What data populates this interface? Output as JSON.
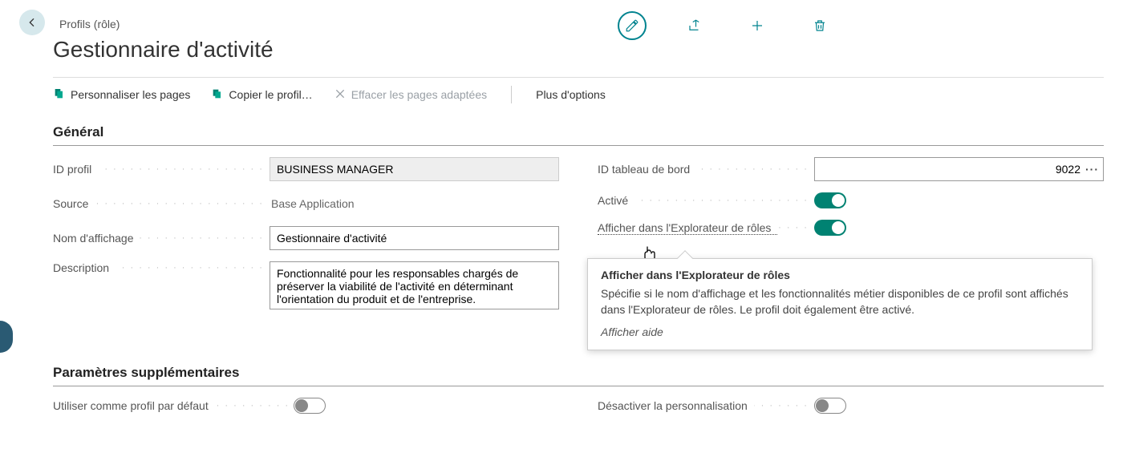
{
  "header": {
    "breadcrumb": "Profils (rôle)",
    "title": "Gestionnaire d'activité"
  },
  "actions": {
    "edit": "edit",
    "share": "share",
    "new": "new",
    "delete": "delete"
  },
  "toolbar": {
    "customize": "Personnaliser les pages",
    "copy": "Copier le profil…",
    "clear": "Effacer les pages adaptées",
    "more": "Plus d'options"
  },
  "sections": {
    "general": "Général",
    "additional": "Paramètres supplémentaires"
  },
  "labels": {
    "profile_id": "ID profil",
    "source": "Source",
    "display_name": "Nom d'affichage",
    "description": "Description",
    "dashboard_id": "ID tableau de bord",
    "enabled": "Activé",
    "show_in_explorer": "Afficher dans l'Explorateur de rôles",
    "default_profile": "Utiliser comme profil par défaut",
    "disable_personalization": "Désactiver la personnalisation"
  },
  "values": {
    "profile_id": "BUSINESS MANAGER",
    "source": "Base Application",
    "display_name": "Gestionnaire d'activité",
    "description": "Fonctionnalité pour les responsables chargés de préserver la viabilité de l'activité en déterminant l'orientation du produit et de l'entreprise.",
    "dashboard_id": "9022",
    "enabled": true,
    "show_in_explorer": true,
    "default_profile": false,
    "disable_personalization": false
  },
  "tooltip": {
    "title": "Afficher dans l'Explorateur de rôles",
    "body": "Spécifie si le nom d'affichage et les fonctionnalités métier disponibles de ce profil sont affichés dans l'Explorateur de rôles. Le profil doit également être activé.",
    "help": "Afficher aide"
  }
}
